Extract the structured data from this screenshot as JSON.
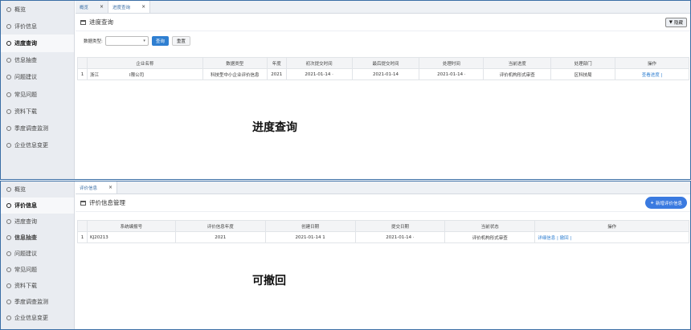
{
  "top": {
    "sidebar": [
      {
        "label": "概览",
        "active": false
      },
      {
        "label": "评价信息",
        "active": false
      },
      {
        "label": "进度查询",
        "active": true
      },
      {
        "label": "信息抽查",
        "active": false
      },
      {
        "label": "问题建议",
        "active": false
      },
      {
        "label": "常见问题",
        "active": false
      },
      {
        "label": "资料下载",
        "active": false
      },
      {
        "label": "季度调查监测",
        "active": false
      },
      {
        "label": "企业信息变更",
        "active": false
      }
    ],
    "tabs": [
      {
        "label": "概览",
        "close": "×"
      },
      {
        "label": "进度查询",
        "close": "×"
      }
    ],
    "header_title": "进度查询",
    "hide_button": "隐藏",
    "filter": {
      "label": "数据类型:",
      "query": "查询",
      "reset": "重置"
    },
    "columns": [
      "",
      "企业名称",
      "数据类型",
      "年度",
      "初次提交时间",
      "最后提交时间",
      "处理时间",
      "当前进度",
      "处理部门",
      "操作"
    ],
    "row": {
      "index": "1",
      "company_prefix": "浙江",
      "company_suffix": "I限公司",
      "type": "科技型中小企业评价信息",
      "year": "2021",
      "first_submit": "2021-01-14 ·",
      "last_submit": "2021-01-14",
      "process_time": "2021-01-14 ·",
      "progress": "评价机构形式审查",
      "department": "区科技局",
      "action": "查看进度 |"
    },
    "caption": "进度查询"
  },
  "bottom": {
    "sidebar": [
      {
        "label": "概览",
        "active": false
      },
      {
        "label": "评价信息",
        "active": true
      },
      {
        "label": "进度查询",
        "active": false
      },
      {
        "label": "信息抽查",
        "active": false
      },
      {
        "label": "问题建议",
        "active": false
      },
      {
        "label": "常见问题",
        "active": false
      },
      {
        "label": "资料下载",
        "active": false
      },
      {
        "label": "季度调查监测",
        "active": false
      },
      {
        "label": "企业信息变更",
        "active": false
      }
    ],
    "tabs": [
      {
        "label": "评价信息",
        "close": "×"
      }
    ],
    "header_title": "评价信息管理",
    "add_button": "新增评价信息",
    "columns": [
      "",
      "系统编报号",
      "评价信息年度",
      "创建日期",
      "提交日期",
      "当前状态",
      "操作"
    ],
    "row": {
      "index": "1",
      "code": "KJ20213",
      "year": "2021",
      "created": "2021-01-14 1",
      "submitted": "2021-01-14 ·",
      "status": "评价机构形式审查",
      "action_detail": "详细信息",
      "action_sep": "|",
      "action_withdraw": "撤回",
      "action_tail": "|"
    },
    "caption": "可撤回"
  },
  "colors": {
    "accent": "#2f7fd1",
    "border": "#3a6ea5",
    "sidebar": "#e9ecf1"
  }
}
